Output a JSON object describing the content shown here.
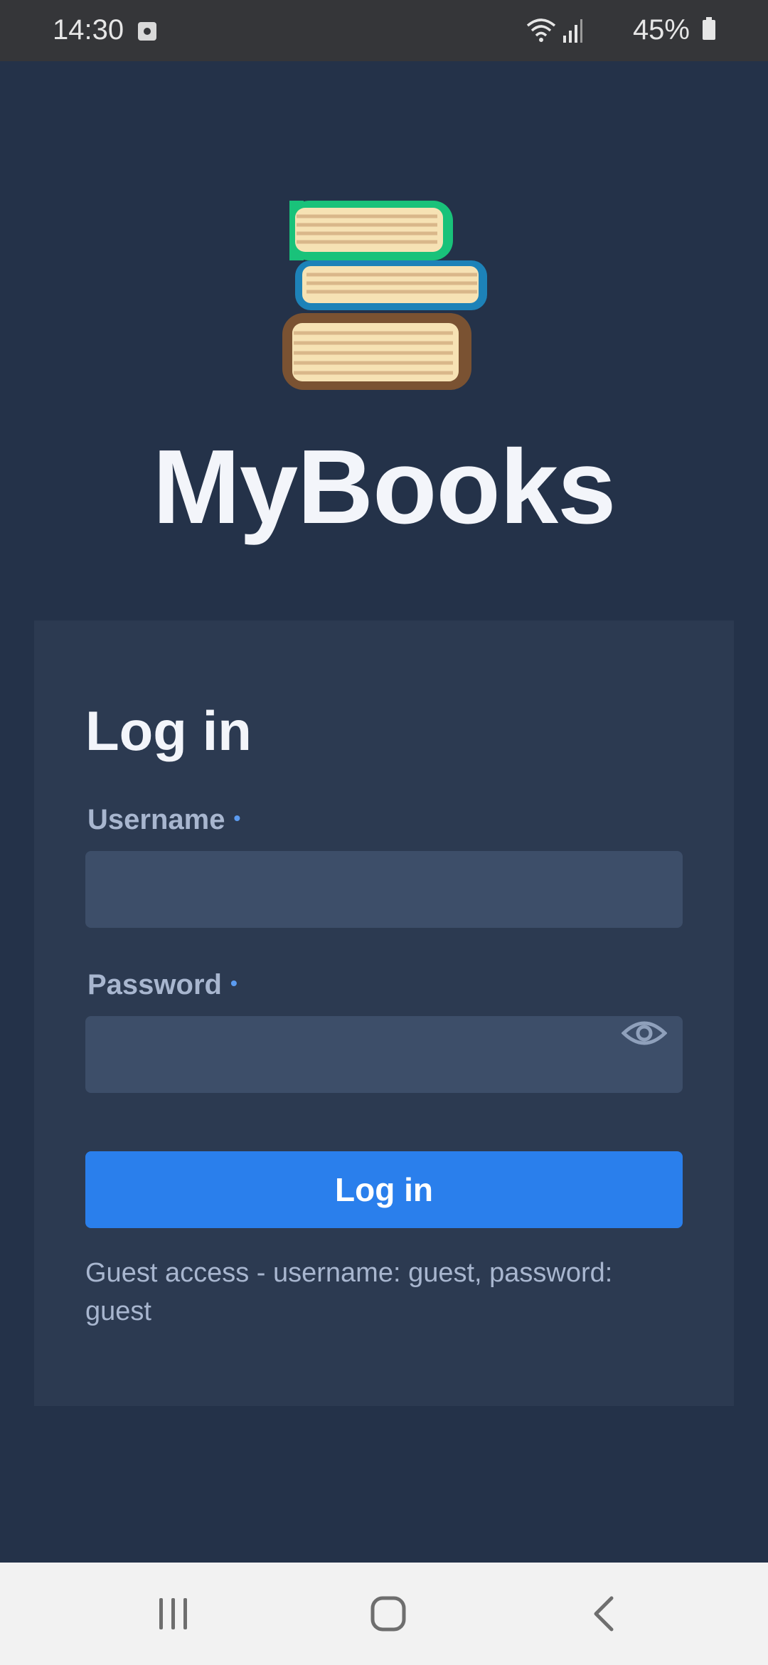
{
  "status_bar": {
    "time": "14:30",
    "battery": "45%",
    "icons": [
      "notification-app-icon",
      "wifi-icon",
      "signal-icon",
      "battery-icon"
    ]
  },
  "app": {
    "title": "MyBooks",
    "logo_icon": "stacked-books-icon"
  },
  "login_form": {
    "title": "Log in",
    "username_label": "Username",
    "username_value": "",
    "password_label": "Password",
    "password_value": "",
    "required_marker": "•",
    "show_password_icon": "eye-icon",
    "submit_label": "Log in",
    "guest_note": "Guest access - username: guest, password: guest"
  },
  "nav_bar": {
    "buttons": [
      "recent-apps-icon",
      "home-icon",
      "back-icon"
    ]
  },
  "colors": {
    "background": "#243249",
    "card": "#2c3a51",
    "input": "#3d4e69",
    "accent": "#2a7fec",
    "label": "#a8b6cf",
    "title": "#f3f5fa"
  }
}
